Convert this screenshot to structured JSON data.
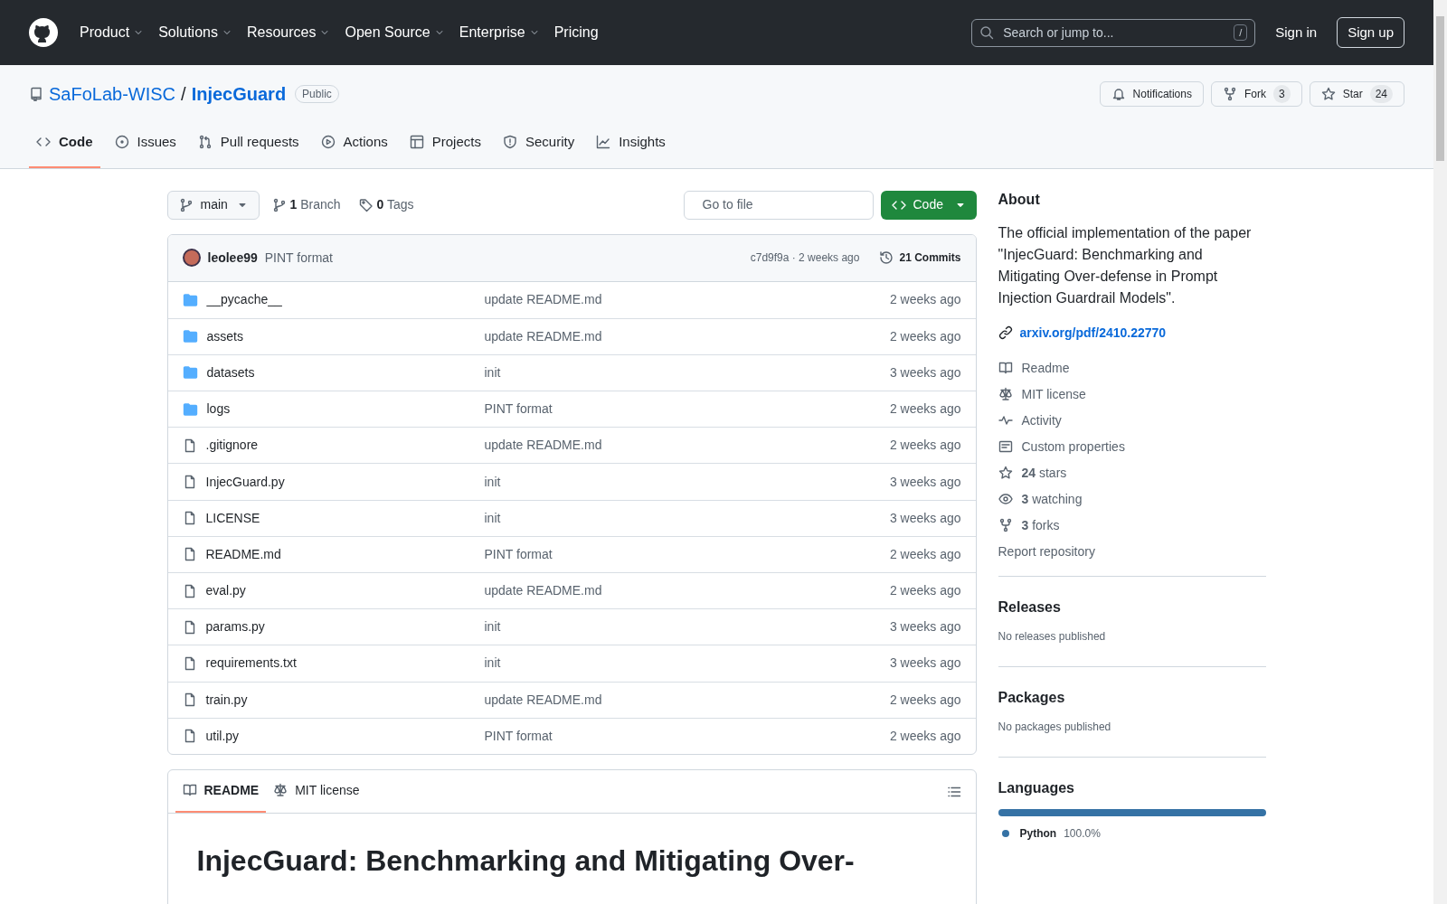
{
  "header": {
    "nav": [
      {
        "label": "Product",
        "dropdown": true
      },
      {
        "label": "Solutions",
        "dropdown": true
      },
      {
        "label": "Resources",
        "dropdown": true
      },
      {
        "label": "Open Source",
        "dropdown": true
      },
      {
        "label": "Enterprise",
        "dropdown": true
      },
      {
        "label": "Pricing",
        "dropdown": false
      }
    ],
    "search": {
      "placeholder": "Search or jump to...",
      "shortcut": "/"
    },
    "sign_in": "Sign in",
    "sign_up": "Sign up"
  },
  "repo": {
    "owner": "SaFoLab-WISC",
    "separator": "/",
    "name": "InjecGuard",
    "visibility": "Public",
    "actions": [
      {
        "label": "Notifications"
      },
      {
        "label": "Fork",
        "count": "3"
      },
      {
        "label": "Star",
        "count": "24"
      }
    ]
  },
  "tabs": [
    {
      "label": "Code",
      "selected": true
    },
    {
      "label": "Issues",
      "selected": false
    },
    {
      "label": "Pull requests",
      "selected": false
    },
    {
      "label": "Actions",
      "selected": false
    },
    {
      "label": "Projects",
      "selected": false
    },
    {
      "label": "Security",
      "selected": false
    },
    {
      "label": "Insights",
      "selected": false
    }
  ],
  "toolbar": {
    "branch": "main",
    "branches": "**1** Branch",
    "tags": "**0** Tags",
    "go_to_file": {
      "placeholder": "Go to file"
    },
    "code_button": "Code"
  },
  "latest_commit": {
    "author": "leolee99",
    "message": "PINT format",
    "meta": "c7d9f9a · 2 weeks ago",
    "commits": "21 Commits"
  },
  "files": [
    {
      "name": "__pycache__",
      "kind": "folder",
      "message": "update README.md",
      "time": "2 weeks ago"
    },
    {
      "name": "assets",
      "kind": "folder",
      "message": "update README.md",
      "time": "2 weeks ago"
    },
    {
      "name": "datasets",
      "kind": "folder",
      "message": "init",
      "time": "3 weeks ago"
    },
    {
      "name": "logs",
      "kind": "folder",
      "message": "PINT format",
      "time": "2 weeks ago"
    },
    {
      "name": ".gitignore",
      "kind": "file",
      "message": "update README.md",
      "time": "2 weeks ago"
    },
    {
      "name": "InjecGuard.py",
      "kind": "file",
      "message": "init",
      "time": "3 weeks ago"
    },
    {
      "name": "LICENSE",
      "kind": "file",
      "message": "init",
      "time": "3 weeks ago"
    },
    {
      "name": "README.md",
      "kind": "file",
      "message": "PINT format",
      "time": "2 weeks ago"
    },
    {
      "name": "eval.py",
      "kind": "file",
      "message": "update README.md",
      "time": "2 weeks ago"
    },
    {
      "name": "params.py",
      "kind": "file",
      "message": "init",
      "time": "3 weeks ago"
    },
    {
      "name": "requirements.txt",
      "kind": "file",
      "message": "init",
      "time": "3 weeks ago"
    },
    {
      "name": "train.py",
      "kind": "file",
      "message": "update README.md",
      "time": "2 weeks ago"
    },
    {
      "name": "util.py",
      "kind": "file",
      "message": "PINT format",
      "time": "2 weeks ago"
    }
  ],
  "readme": {
    "tabs": [
      {
        "label": "README",
        "selected": true
      },
      {
        "label": "MIT license",
        "selected": false
      }
    ],
    "heading": "InjecGuard: Benchmarking and Mitigating Over-"
  },
  "about": {
    "title": "About",
    "description": "The official implementation of the paper \"InjecGuard: Benchmarking and Mitigating Over-defense in Prompt Injection Guardrail Models\".",
    "link": "arxiv.org/pdf/2410.22770",
    "items": [
      "Readme",
      "MIT license",
      "Activity",
      "Custom properties",
      "**24** stars",
      "**3** watching",
      "**3** forks"
    ],
    "report": "Report repository"
  },
  "releases": {
    "title": "Releases",
    "note": "No releases published"
  },
  "packages": {
    "title": "Packages",
    "note": "No packages published"
  },
  "languages": {
    "title": "Languages",
    "items": [
      {
        "name": "Python",
        "percent": "100.0%",
        "color": "#3572a5",
        "level": 1.0
      }
    ]
  }
}
